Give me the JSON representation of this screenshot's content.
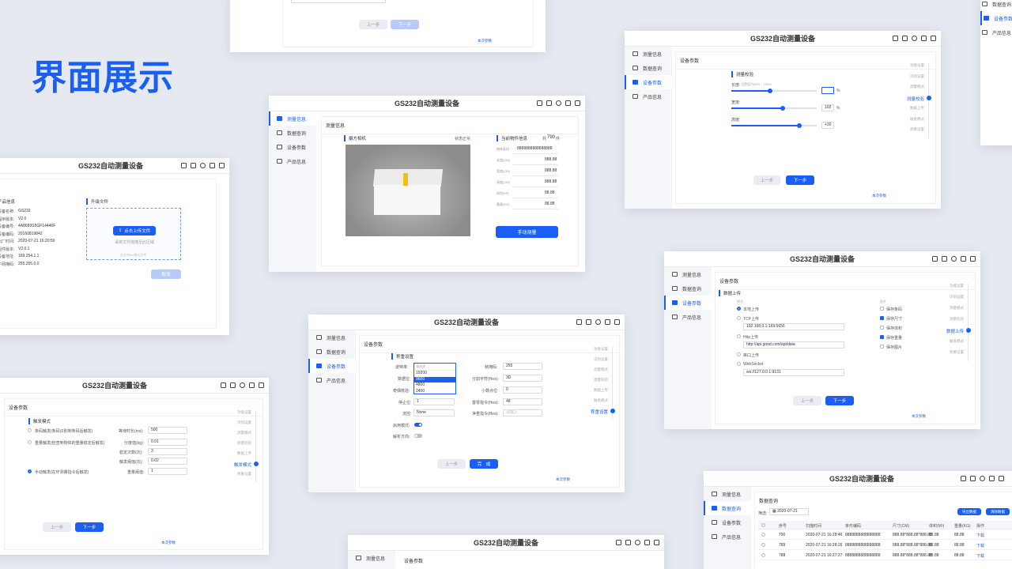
{
  "headline": "界面展示",
  "app_title": "GS232自动测量设备",
  "nav": [
    "测量信息",
    "数据查询",
    "设备参数",
    "产品信息"
  ],
  "steps": [
    "功能设置",
    "识别设置",
    "测量模式",
    "测量校验",
    "数据上传",
    "触发模式",
    "称重设置"
  ],
  "common": {
    "prev": "上一步",
    "next": "下一步",
    "done": "完　成",
    "cancel": "取消",
    "manual": "本次参数"
  },
  "w_measure": {
    "title": "测量信息",
    "camera": "摄方相机",
    "status_label": "状态:",
    "status_value": "正常",
    "object": "当前物件信息",
    "count_label": "共",
    "count": "790",
    "count_unit": "件",
    "fields": [
      {
        "label": "物体条码",
        "value": "8888888888888888"
      },
      {
        "label": "长度(CM)",
        "value": "888.88"
      },
      {
        "label": "宽度(CM)",
        "value": "888.88"
      },
      {
        "label": "高度(CM)",
        "value": "888.88"
      },
      {
        "label": "体积(M³)",
        "value": "88.88"
      },
      {
        "label": "重量(KG)",
        "value": "88.88"
      }
    ],
    "button": "手动测量"
  },
  "w_product": {
    "section": "产品信息",
    "upgrade": "升级文件",
    "rows": [
      {
        "label": "设备名称:",
        "value": "GS232"
      },
      {
        "label": "程序版本:",
        "value": "V2.0"
      },
      {
        "label": "设备编号:",
        "value": "4A8689S5GF14446F"
      },
      {
        "label": "设备编码:",
        "value": "20160819842"
      },
      {
        "label": "出厂时间:",
        "value": "2020-07-21 16:20:50"
      },
      {
        "label": "固件版本:",
        "value": "V2.0.1"
      },
      {
        "label": "设备地址:",
        "value": "169.254.1.1"
      },
      {
        "label": "子网掩码:",
        "value": "255.255.0.0"
      }
    ],
    "upload_btn": "点击上传文件",
    "hint": "请将文件拖拽至此区域",
    "hint2": "仅支持bin格式文件"
  },
  "w_check": {
    "section": "设备参数",
    "sub": "测量校验",
    "length_label": "长度:",
    "length_hint": "设置值为80% ~ 120%",
    "length_val": "",
    "length_unit": "%",
    "length_level": 0.45,
    "width_label": "宽度:",
    "width_val": "102",
    "width_unit": "%",
    "width_level": 0.6,
    "height_label": "高度:",
    "height_val": "+30",
    "height_level": 0.8
  },
  "w_serial": {
    "section": "设备参数",
    "sub": "称重设置",
    "baud_label": "波特率:",
    "baud_placeholder": "请选择",
    "baud_options": [
      "19200",
      "9600",
      "4800",
      "2400"
    ],
    "databits_label": "数据位:",
    "parity_label": "奇偶校验:",
    "stopbits_label": "停止位:",
    "stopbits_val": "1",
    "flow_label": "流控:",
    "flow_val": "None",
    "check_label": "启用模式:",
    "parse_label": "解析方向:",
    "frame_label": "帧掩码:",
    "frame_val": "255",
    "sep_label": "分割字符(Hex):",
    "sep_val": "3D",
    "dec_label": "小数点位:",
    "dec_val": "0",
    "zero_label": "置零指令(Hex):",
    "zero_val": "48",
    "net_label": "净重指令(Hex):",
    "net_placeholder": "请输入"
  },
  "w_upload": {
    "section": "设备参数",
    "sub": "数据上传",
    "mode_label": "模式",
    "local": "本地上传",
    "tcp": "TCP上传",
    "tcp_val": "192.168.0.1:169:5656",
    "http": "Http上传",
    "http_val": "http://api.good.com/api/data",
    "serial": "串口上传",
    "ws": "WebSocket",
    "ws_val": "ws://127.0.0.1:9131",
    "opt_label": "条件",
    "opts": [
      {
        "label": "保存条码",
        "on": false
      },
      {
        "label": "保存尺寸",
        "on": true
      },
      {
        "label": "保存体积",
        "on": false
      },
      {
        "label": "保存重量",
        "on": true
      },
      {
        "label": "保存图片",
        "on": false
      }
    ]
  },
  "w_trigger": {
    "section": "设备参数",
    "sub": "触发模式",
    "opt1": "条码触发(条码识别到条码后触发)",
    "opt2": "重量触发(检查到物体的重量稳定后触发)",
    "opt3": "手动触发(在环测量指令后触发)",
    "f1_label": "等待时长(ms):",
    "f1_val": "500",
    "f2_label": "分度值(kg):",
    "f2_val": "0.01",
    "f3_label": "稳定次数(次):",
    "f3_val": "3",
    "f4_label": "触发阈值(次):",
    "f4_val": "0.02",
    "f5_label": "重量阈值:",
    "f5_val": "1"
  },
  "w_query": {
    "section": "数据查询",
    "filter_label": "筛选:",
    "date": "2020-07-21",
    "export": "导出数据",
    "clear": "清除数据",
    "headers": [
      "序号",
      "扫描时间",
      "条形编码",
      "尺寸(CM)",
      "体积(M³)",
      "重量(KG)",
      "操作"
    ],
    "rows": [
      [
        "790",
        "2020-07-21 16:28:46",
        "8888888888888888",
        "888.88*888.88*888.88",
        "88.88",
        "88.88",
        "下载"
      ],
      [
        "789",
        "2020-07-21 16:28:26",
        "8888888888888888",
        "888.88*888.88*888.88",
        "88.88",
        "88.88",
        "下载"
      ],
      [
        "788",
        "2020-07-21 16:27:27",
        "8888888888888888",
        "888.88*888.88*888.88",
        "88.88",
        "88.88",
        "下载"
      ]
    ]
  },
  "w_bottom": {
    "section": "设备参数"
  }
}
